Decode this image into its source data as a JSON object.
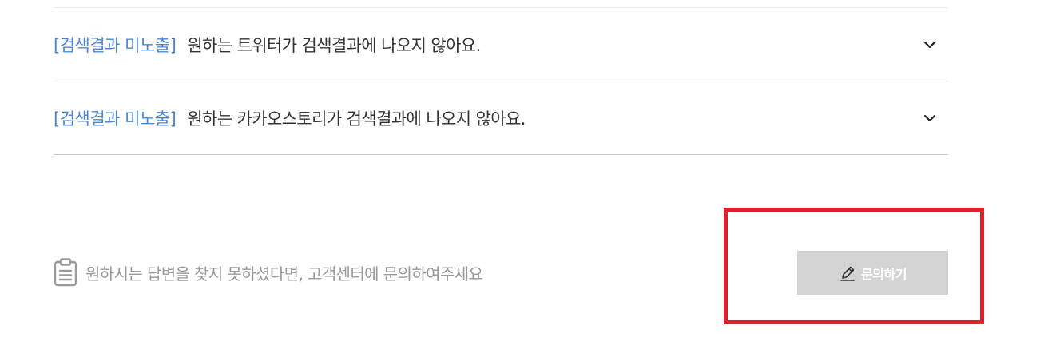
{
  "faq": {
    "items": [
      {
        "category": "[검색결과 미노출]",
        "question": "원하는 트위터가 검색결과에 나오지 않아요.",
        "expand_icon": "chevron-down-icon"
      },
      {
        "category": "[검색결과 미노출]",
        "question": "원하는 카카오스토리가 검색결과에 나오지 않아요.",
        "expand_icon": "chevron-down-icon"
      }
    ]
  },
  "help": {
    "icon": "clipboard-icon",
    "text": "원하시는 답변을 찾지 못하셨다면, 고객센터에 문의하여주세요"
  },
  "inquiry_button": {
    "icon": "pencil-icon",
    "label": "문의하기"
  },
  "colors": {
    "category": "#4a86d8",
    "question_text": "#333333",
    "help_text": "#999999",
    "button_bg": "#d4d4d4",
    "highlight": "#e02028"
  }
}
